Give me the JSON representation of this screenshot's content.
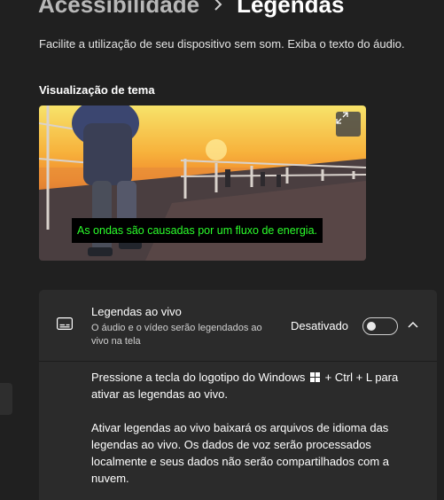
{
  "header": {
    "parent": "Acessibilidade",
    "current": "Legendas"
  },
  "description": "Facilite a utilização de seu dispositivo sem som. Exiba o texto do áudio.",
  "preview": {
    "title": "Visualização de tema",
    "caption": "As ondas são causadas por um fluxo de energia.",
    "expand_icon": "expand-icon"
  },
  "live_captions": {
    "title": "Legendas ao vivo",
    "subtitle": "O áudio e o vídeo serão legendados ao vivo na tela",
    "state_label": "Desativado",
    "toggle_on": false,
    "icon": "captions-icon",
    "shortcut_before": "Pressione a tecla do logotipo do Windows",
    "shortcut_after": "+ Ctrl + L para ativar as legendas ao vivo.",
    "note": "Ativar legendas ao vivo baixará os arquivos de idioma das legendas ao vivo. Os dados de voz serão processados localmente e seus dados não serão compartilhados com a nuvem."
  }
}
